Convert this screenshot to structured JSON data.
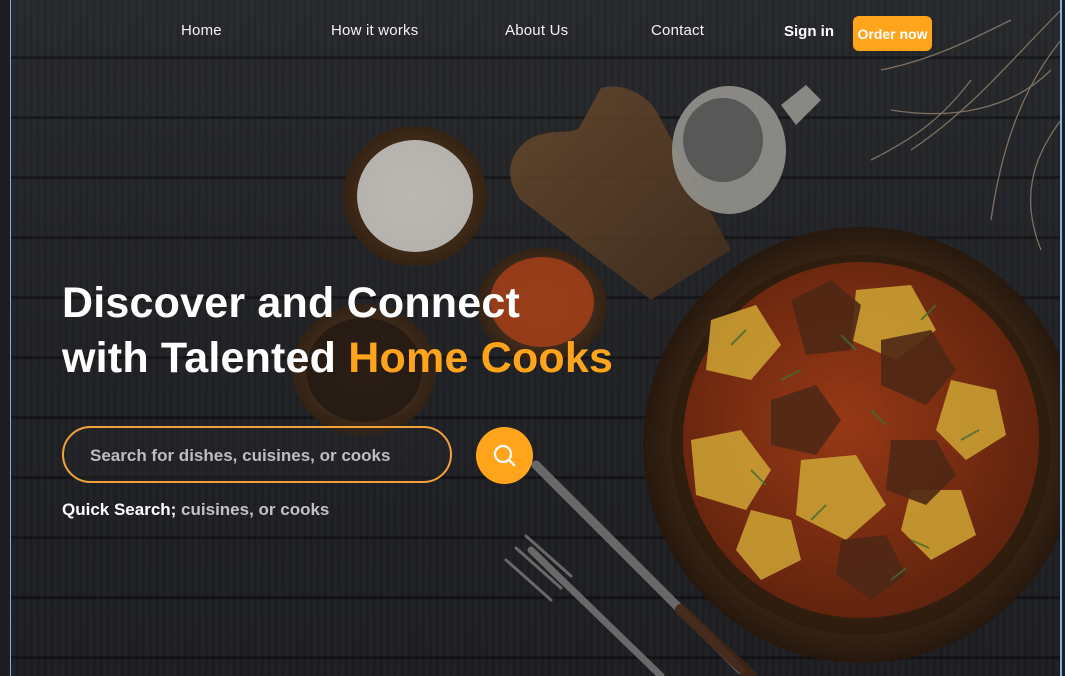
{
  "nav": {
    "links": [
      {
        "label": "Home"
      },
      {
        "label": "How it works"
      },
      {
        "label": "About Us"
      },
      {
        "label": "Contact"
      }
    ],
    "signin_label": "Sign in",
    "order_label": "Order now"
  },
  "hero": {
    "headline_line1": "Discover and Connect",
    "headline_line2_prefix": "with Talented ",
    "headline_line2_accent": "Home Cooks"
  },
  "search": {
    "placeholder": "Search for dishes, cuisines, or cooks",
    "button_icon": "search-icon"
  },
  "quick_search": {
    "label": "Quick Search;",
    "options": " cuisines, or cooks"
  },
  "colors": {
    "accent": "#ffa41b",
    "background": "#222428",
    "text": "#ffffff"
  }
}
